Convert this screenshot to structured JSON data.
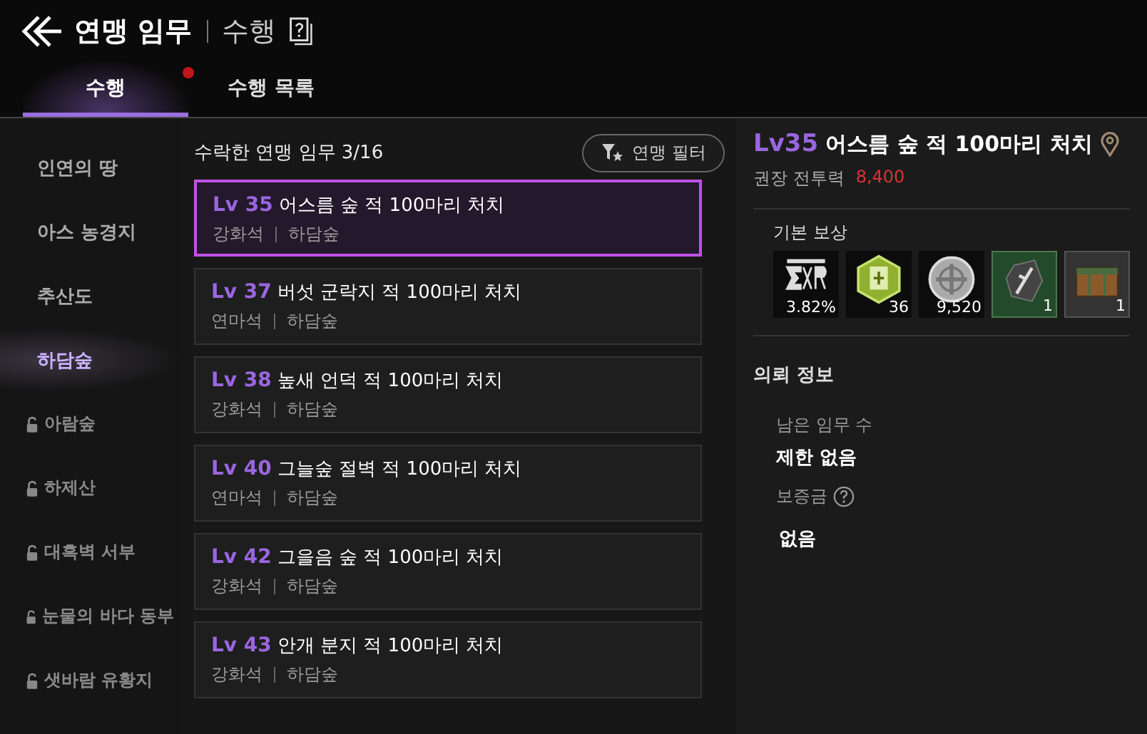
{
  "header": {
    "title": "연맹 임무",
    "subtitle": "수행"
  },
  "tabs": [
    {
      "label": "수행",
      "selected": true,
      "badge": true
    },
    {
      "label": "수행 목록",
      "selected": false,
      "badge": false
    }
  ],
  "sidebar": {
    "items": [
      {
        "label": "인연의 땅",
        "selected": false,
        "locked": false
      },
      {
        "label": "아스 농경지",
        "selected": false,
        "locked": false
      },
      {
        "label": "추산도",
        "selected": false,
        "locked": false
      },
      {
        "label": "하담숲",
        "selected": true,
        "locked": false
      },
      {
        "label": "아람숲",
        "selected": false,
        "locked": true
      },
      {
        "label": "하제산",
        "selected": false,
        "locked": true
      },
      {
        "label": "대흑벽 서부",
        "selected": false,
        "locked": true
      },
      {
        "label": "눈물의 바다 동부",
        "selected": false,
        "locked": true
      },
      {
        "label": "샛바람 유황지",
        "selected": false,
        "locked": true
      }
    ]
  },
  "quest_list": {
    "heading": "수락한 연맹 임무 3/16",
    "filter_button": "연맹 필터",
    "items": [
      {
        "level": "Lv 35",
        "title": "어스름 숲 적 100마리 처치",
        "reward": "강화석",
        "region": "하담숲",
        "selected": true
      },
      {
        "level": "Lv 37",
        "title": "버섯 군락지 적 100마리 처치",
        "reward": "연마석",
        "region": "하담숲",
        "selected": false
      },
      {
        "level": "Lv 38",
        "title": "높새 언덕 적 100마리 처치",
        "reward": "강화석",
        "region": "하담숲",
        "selected": false
      },
      {
        "level": "Lv 40",
        "title": "그늘숲 절벽 적 100마리 처치",
        "reward": "연마석",
        "region": "하담숲",
        "selected": false
      },
      {
        "level": "Lv 42",
        "title": "그을음 숲 적 100마리 처치",
        "reward": "강화석",
        "region": "하담숲",
        "selected": false
      },
      {
        "level": "Lv 43",
        "title": "안개 분지 적 100마리 처치",
        "reward": "강화석",
        "region": "하담숲",
        "selected": false
      }
    ]
  },
  "detail": {
    "level": "Lv35",
    "title": "어스름 숲 적 100마리 처치",
    "power_label": "권장 전투력",
    "power_value": "8,400",
    "rewards_heading": "기본 보상",
    "rewards": [
      {
        "kind": "exp",
        "count": "3.82%"
      },
      {
        "kind": "token",
        "count": "36"
      },
      {
        "kind": "coin",
        "count": "9,520"
      },
      {
        "kind": "stone",
        "count": "1"
      },
      {
        "kind": "chest",
        "count": "1"
      }
    ],
    "info_heading": "의뢰 정보",
    "remaining_label": "남은 임무 수",
    "remaining_value": "제한 없음",
    "deposit_label": "보증금",
    "deposit_value": "없음"
  }
}
